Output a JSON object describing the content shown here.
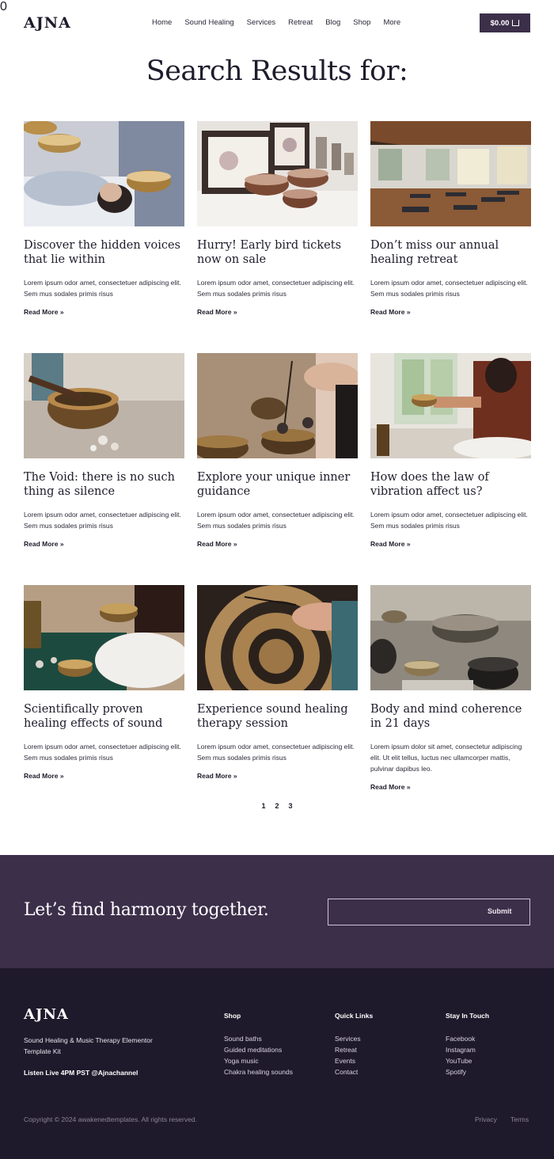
{
  "header": {
    "logo": "AJNA",
    "nav": [
      "Home",
      "Sound Healing",
      "Services",
      "Retreat",
      "Blog",
      "Shop",
      "More"
    ],
    "cart_total": "$0.00",
    "cart_count": "0"
  },
  "page_title": "Search Results for:",
  "posts": [
    {
      "title": "Discover the hidden voices that lie within",
      "excerpt": "Lorem ipsum odor amet, consectetuer adipiscing elit. Sem mus sodales primis risus",
      "more": "Read More »"
    },
    {
      "title": "Hurry! Early bird tickets now on sale",
      "excerpt": "Lorem ipsum odor amet, consectetuer adipiscing elit. Sem mus sodales primis risus",
      "more": "Read More »"
    },
    {
      "title": "Don’t miss our annual healing retreat",
      "excerpt": "Lorem ipsum odor amet, consectetuer adipiscing elit. Sem mus sodales primis risus",
      "more": "Read More »"
    },
    {
      "title": "The Void: there is no such thing as silence",
      "excerpt": "Lorem ipsum odor amet, consectetuer adipiscing elit. Sem mus sodales primis risus",
      "more": "Read More »"
    },
    {
      "title": "Explore your unique inner guidance",
      "excerpt": "Lorem ipsum odor amet, consectetuer adipiscing elit. Sem mus sodales primis risus",
      "more": "Read More »"
    },
    {
      "title": "How does the law of vibration affect us?",
      "excerpt": "Lorem ipsum odor amet, consectetuer adipiscing elit. Sem mus sodales primis risus",
      "more": "Read More »"
    },
    {
      "title": "Scientifically proven healing effects of sound",
      "excerpt": "Lorem ipsum odor amet, consectetuer adipiscing elit. Sem mus sodales primis risus",
      "more": "Read More »"
    },
    {
      "title": "Experience sound healing therapy session",
      "excerpt": "Lorem ipsum odor amet, consectetuer adipiscing elit. Sem mus sodales primis risus",
      "more": "Read More »"
    },
    {
      "title": "Body and mind coherence in 21 days",
      "excerpt": "Lorem ipsum dolor sit amet, consectetur adipiscing elit. Ut elit tellus, luctus nec ullamcorper mattis, pulvinar dapibus leo.",
      "more": "Read More »"
    }
  ],
  "pagination": [
    "1",
    "2",
    "3"
  ],
  "newsletter": {
    "tagline": "Let’s find harmony together.",
    "submit": "Submit"
  },
  "footer": {
    "logo": "AJNA",
    "description": "Sound Healing & Music Therapy Elementor Template Kit",
    "live": "Listen Live 4PM PST @Ajnachannel",
    "shop": {
      "heading": "Shop",
      "links": [
        "Sound baths",
        "Guided meditations",
        "Yoga music",
        "Chakra healing sounds"
      ]
    },
    "quick": {
      "heading": "Quick Links",
      "links": [
        "Services",
        "Retreat",
        "Events",
        "Contact"
      ]
    },
    "touch": {
      "heading": "Stay In Touch",
      "links": [
        "Facebook",
        "Instagram",
        "YouTube",
        "Spotify"
      ]
    },
    "copyright": "Copyright © 2024 awakenedtemplates. All rights reserved.",
    "privacy": "Privacy",
    "terms": "Terms"
  },
  "colors": {
    "accent": "#3c2f4a",
    "footer_bg": "#1f1a2b",
    "text": "#1f1b2b"
  }
}
